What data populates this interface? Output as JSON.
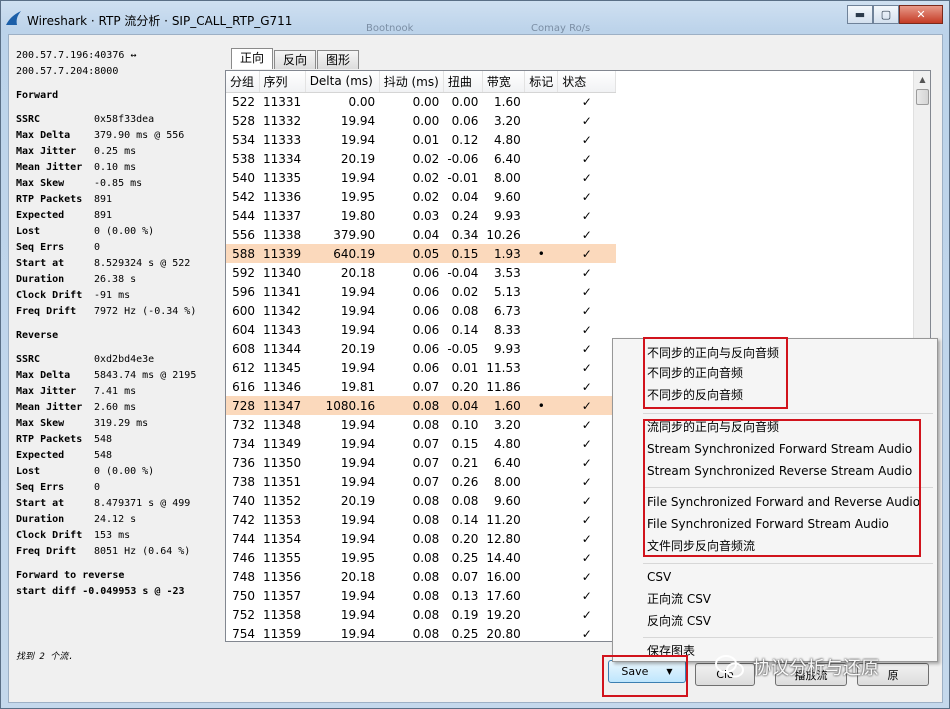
{
  "window": {
    "title": "Wireshark · RTP 流分析 · SIP_CALL_RTP_G711",
    "ghost_left": "Bootnook",
    "ghost_right": "Comay Ro/s",
    "minimize": "▬",
    "maximize": "▢",
    "close": "✕"
  },
  "stream": {
    "line1": "200.57.7.196:40376 ↔",
    "line2": "200.57.7.204:8000"
  },
  "forward": {
    "heading": "Forward",
    "stats": [
      {
        "k": "SSRC",
        "v": "0x58f33dea"
      },
      {
        "k": "Max Delta",
        "v": "379.90 ms @ 556"
      },
      {
        "k": "Max Jitter",
        "v": "0.25 ms"
      },
      {
        "k": "Mean Jitter",
        "v": "0.10 ms"
      },
      {
        "k": "Max Skew",
        "v": "-0.85 ms"
      },
      {
        "k": "RTP Packets",
        "v": "891"
      },
      {
        "k": "Expected",
        "v": "891"
      },
      {
        "k": "Lost",
        "v": "0 (0.00 %)"
      },
      {
        "k": "Seq Errs",
        "v": "0"
      },
      {
        "k": "Start at",
        "v": "8.529324 s @ 522"
      },
      {
        "k": "Duration",
        "v": "26.38 s"
      },
      {
        "k": "Clock Drift",
        "v": "-91 ms"
      },
      {
        "k": "Freq Drift",
        "v": "7972 Hz (-0.34 %)"
      }
    ]
  },
  "reverse": {
    "heading": "Reverse",
    "stats": [
      {
        "k": "SSRC",
        "v": "0xd2bd4e3e"
      },
      {
        "k": "Max Delta",
        "v": "5843.74 ms @ 2195"
      },
      {
        "k": "Max Jitter",
        "v": "7.41 ms"
      },
      {
        "k": "Mean Jitter",
        "v": "2.60 ms"
      },
      {
        "k": "Max Skew",
        "v": "319.29 ms"
      },
      {
        "k": "RTP Packets",
        "v": "548"
      },
      {
        "k": "Expected",
        "v": "548"
      },
      {
        "k": "Lost",
        "v": "0 (0.00 %)"
      },
      {
        "k": "Seq Errs",
        "v": "0"
      },
      {
        "k": "Start at",
        "v": "8.479371 s @ 499"
      },
      {
        "k": "Duration",
        "v": "24.12 s"
      },
      {
        "k": "Clock Drift",
        "v": "153 ms"
      },
      {
        "k": "Freq Drift",
        "v": "8051 Hz (0.64 %)"
      }
    ]
  },
  "diff": {
    "line1": "Forward to reverse",
    "line2": "start diff -0.049953 s @ -23"
  },
  "found_text": "找到 2 个流.",
  "tabs": [
    "正向",
    "反向",
    "图形"
  ],
  "table": {
    "headers": [
      "分组",
      "序列",
      "Delta (ms)",
      "抖动 (ms)",
      "扭曲",
      "带宽",
      "标记",
      "状态"
    ],
    "rows": [
      [
        "522",
        "11331",
        "0.00",
        "0.00",
        "0.00",
        "1.60",
        "",
        "✓"
      ],
      [
        "528",
        "11332",
        "19.94",
        "0.00",
        "0.06",
        "3.20",
        "",
        "✓"
      ],
      [
        "534",
        "11333",
        "19.94",
        "0.01",
        "0.12",
        "4.80",
        "",
        "✓"
      ],
      [
        "538",
        "11334",
        "20.19",
        "0.02",
        "-0.06",
        "6.40",
        "",
        "✓"
      ],
      [
        "540",
        "11335",
        "19.94",
        "0.02",
        "-0.01",
        "8.00",
        "",
        "✓"
      ],
      [
        "542",
        "11336",
        "19.95",
        "0.02",
        "0.04",
        "9.60",
        "",
        "✓"
      ],
      [
        "544",
        "11337",
        "19.80",
        "0.03",
        "0.24",
        "9.93",
        "",
        "✓"
      ],
      [
        "556",
        "11338",
        "379.90",
        "0.04",
        "0.34",
        "10.26",
        "",
        "✓"
      ],
      [
        "588",
        "11339",
        "640.19",
        "0.05",
        "0.15",
        "1.93",
        "•",
        "✓"
      ],
      [
        "592",
        "11340",
        "20.18",
        "0.06",
        "-0.04",
        "3.53",
        "",
        "✓"
      ],
      [
        "596",
        "11341",
        "19.94",
        "0.06",
        "0.02",
        "5.13",
        "",
        "✓"
      ],
      [
        "600",
        "11342",
        "19.94",
        "0.06",
        "0.08",
        "6.73",
        "",
        "✓"
      ],
      [
        "604",
        "11343",
        "19.94",
        "0.06",
        "0.14",
        "8.33",
        "",
        "✓"
      ],
      [
        "608",
        "11344",
        "20.19",
        "0.06",
        "-0.05",
        "9.93",
        "",
        "✓"
      ],
      [
        "612",
        "11345",
        "19.94",
        "0.06",
        "0.01",
        "11.53",
        "",
        "✓"
      ],
      [
        "616",
        "11346",
        "19.81",
        "0.07",
        "0.20",
        "11.86",
        "",
        "✓"
      ],
      [
        "728",
        "11347",
        "1080.16",
        "0.08",
        "0.04",
        "1.60",
        "•",
        "✓"
      ],
      [
        "732",
        "11348",
        "19.94",
        "0.08",
        "0.10",
        "3.20",
        "",
        "✓"
      ],
      [
        "734",
        "11349",
        "19.94",
        "0.07",
        "0.15",
        "4.80",
        "",
        "✓"
      ],
      [
        "736",
        "11350",
        "19.94",
        "0.07",
        "0.21",
        "6.40",
        "",
        "✓"
      ],
      [
        "738",
        "11351",
        "19.94",
        "0.07",
        "0.26",
        "8.00",
        "",
        "✓"
      ],
      [
        "740",
        "11352",
        "20.19",
        "0.08",
        "0.08",
        "9.60",
        "",
        "✓"
      ],
      [
        "742",
        "11353",
        "19.94",
        "0.08",
        "0.14",
        "11.20",
        "",
        "✓"
      ],
      [
        "744",
        "11354",
        "19.94",
        "0.08",
        "0.20",
        "12.80",
        "",
        "✓"
      ],
      [
        "746",
        "11355",
        "19.95",
        "0.08",
        "0.25",
        "14.40",
        "",
        "✓"
      ],
      [
        "748",
        "11356",
        "20.18",
        "0.08",
        "0.07",
        "16.00",
        "",
        "✓"
      ],
      [
        "750",
        "11357",
        "19.94",
        "0.08",
        "0.13",
        "17.60",
        "",
        "✓"
      ],
      [
        "752",
        "11358",
        "19.94",
        "0.08",
        "0.19",
        "19.20",
        "",
        "✓"
      ],
      [
        "754",
        "11359",
        "19.94",
        "0.08",
        "0.25",
        "20.80",
        "",
        "✓"
      ]
    ],
    "highlight_color": "#fbd9bc"
  },
  "menu": {
    "unsync": [
      "不同步的正向与反向音频",
      "不同步的正向音频",
      "不同步的反向音频"
    ],
    "stream_sync": [
      "流同步的正向与反向音频",
      "Stream Synchronized Forward Stream Audio",
      "Stream Synchronized Reverse Stream Audio"
    ],
    "file_sync": [
      "File Synchronized Forward and Reverse Audio",
      "File Synchronized Forward Stream Audio",
      "文件同步反向音频流"
    ],
    "csv": [
      "CSV",
      "正向流 CSV",
      "反向流 CSV"
    ],
    "save_graph": "保存图表"
  },
  "buttons": {
    "save": "Save",
    "close": "Clo",
    "play": "播放流",
    "help": "原"
  },
  "watermark": "协议分析与还原",
  "annotation_color": "#d1131c"
}
